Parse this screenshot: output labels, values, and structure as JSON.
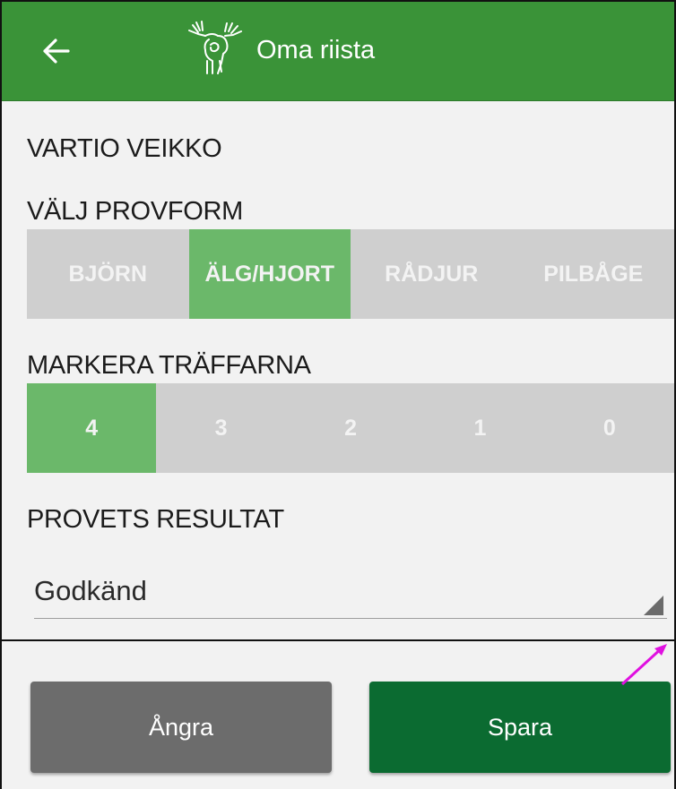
{
  "app": {
    "title": "Oma riista"
  },
  "icons": {
    "back": "arrow-left-icon",
    "logo": "moose-logo-icon",
    "dropdown": "dropdown-triangle-icon"
  },
  "colors": {
    "appbar": "#3a9338",
    "selected": "#6bb86a",
    "unselected": "#cfcfcf",
    "save_button": "#0b6b31",
    "cancel_button": "#6c6c6c"
  },
  "person": {
    "name": "VARTIO VEIKKO"
  },
  "test_type": {
    "label": "VÄLJ PROVFORM",
    "options": [
      "BJÖRN",
      "ÄLG/HJORT",
      "RÅDJUR",
      "PILBÅGE"
    ],
    "selected": "ÄLG/HJORT"
  },
  "hits": {
    "label": "MARKERA TRÄFFARNA",
    "options": [
      "4",
      "3",
      "2",
      "1",
      "0"
    ],
    "selected": "4"
  },
  "result": {
    "label": "PROVETS RESULTAT",
    "value": "Godkänd"
  },
  "actions": {
    "cancel_label": "Ångra",
    "save_label": "Spara"
  }
}
